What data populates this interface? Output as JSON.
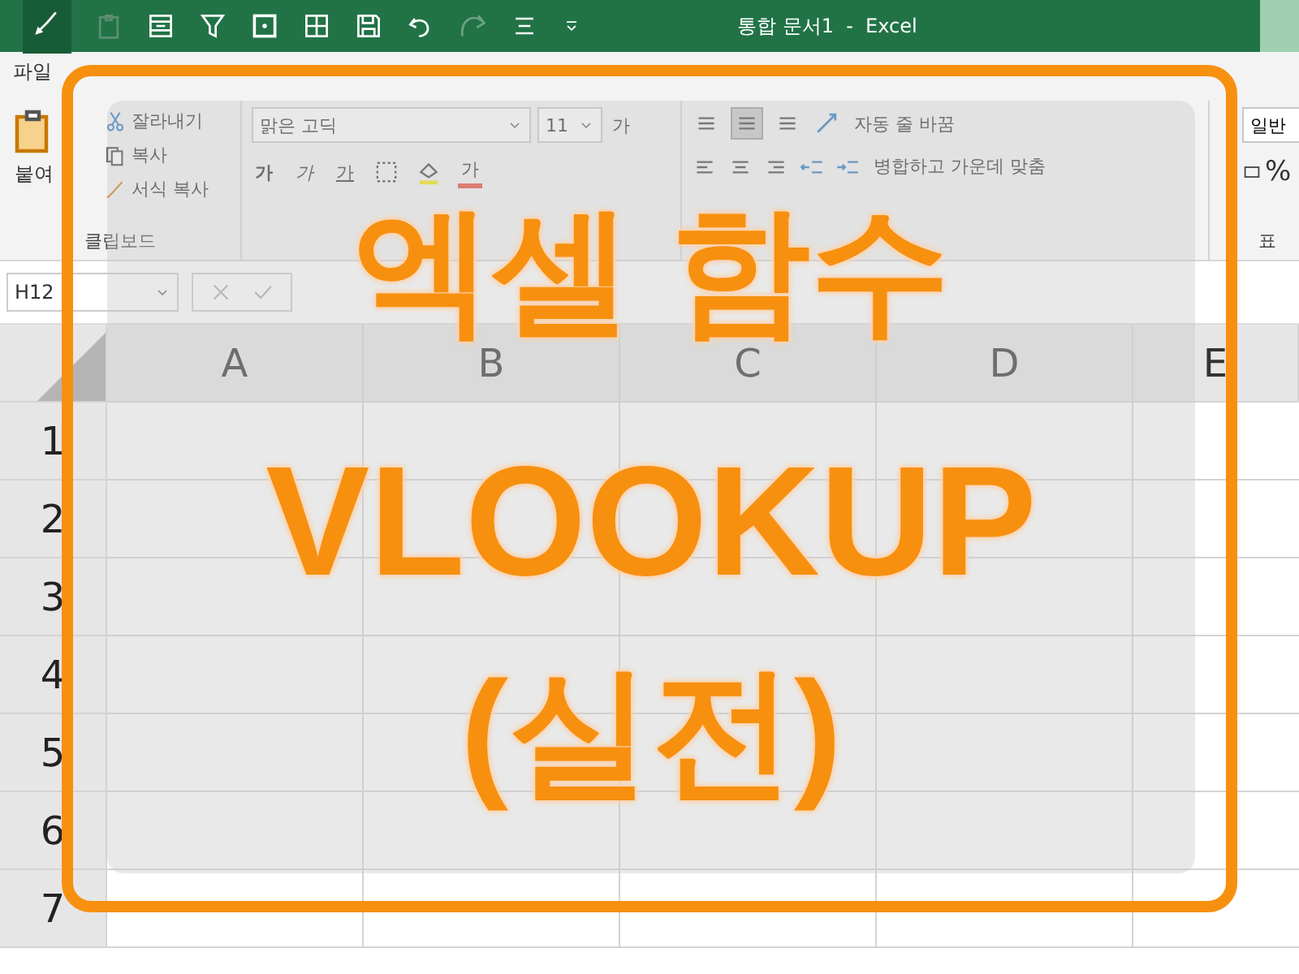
{
  "window": {
    "title": "통합 문서1  -  Excel"
  },
  "ribbon_tabs": [
    {
      "label": "파일",
      "selected": false
    }
  ],
  "clipboard": {
    "paste": "붙여",
    "cut": "잘라내기",
    "copy": "복사",
    "format_painter": "서식 복사",
    "group": "클립보드"
  },
  "font": {
    "name": "맑은 고딕",
    "size": "11",
    "grow": "가",
    "bold": "가",
    "italic": "가",
    "underline": "가",
    "font_color": "가"
  },
  "alignment": {
    "vertical": [
      {
        "selected": false
      },
      {
        "selected": true
      },
      {
        "selected": false
      }
    ],
    "wrap": "자동 줄 바꿈",
    "merge": "병합하고 가운데 맞춤"
  },
  "number": {
    "format": "일반",
    "percent": "%",
    "group": "표"
  },
  "name_box": {
    "value": "H12"
  },
  "sheet": {
    "columns": [
      "A",
      "B",
      "C",
      "D",
      "E"
    ],
    "rows": [
      "1",
      "2",
      "3",
      "4",
      "5",
      "6",
      "7"
    ]
  },
  "overlay": {
    "lines": [
      "엑셀 함수",
      "VLOOKUP",
      "(실전)"
    ]
  }
}
